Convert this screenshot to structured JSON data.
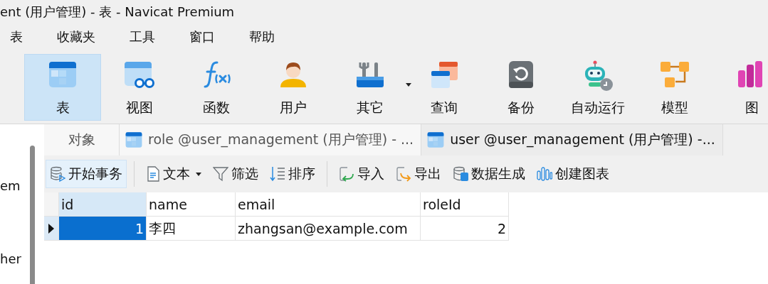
{
  "window": {
    "title": "ent (用户管理) - 表 - Navicat Premium"
  },
  "menu": [
    "表",
    "收藏夹",
    "工具",
    "窗口",
    "帮助"
  ],
  "toolbar": [
    {
      "label": "表",
      "kind": "table",
      "selected": true,
      "dropdown": false
    },
    {
      "label": "视图",
      "kind": "view",
      "selected": false,
      "dropdown": false
    },
    {
      "label": "函数",
      "kind": "function",
      "selected": false,
      "dropdown": false
    },
    {
      "label": "用户",
      "kind": "user",
      "selected": false,
      "dropdown": false
    },
    {
      "label": "其它",
      "kind": "tools",
      "selected": false,
      "dropdown": true
    },
    {
      "label": "查询",
      "kind": "query",
      "selected": false,
      "dropdown": false
    },
    {
      "label": "备份",
      "kind": "backup",
      "selected": false,
      "dropdown": false
    },
    {
      "label": "自动运行",
      "kind": "robot",
      "selected": false,
      "dropdown": false
    },
    {
      "label": "模型",
      "kind": "model",
      "selected": false,
      "dropdown": false
    },
    {
      "label": "图",
      "kind": "chart",
      "selected": false,
      "dropdown": false
    }
  ],
  "sidebar": {
    "items": [
      "em",
      "her"
    ]
  },
  "tabs": [
    {
      "label": "对象",
      "kind": "objects",
      "selected": false
    },
    {
      "label": "role @user_management (用户管理) - ...",
      "kind": "table",
      "selected": false
    },
    {
      "label": "user @user_management (用户管理) -...",
      "kind": "table",
      "selected": true
    }
  ],
  "data_toolbar": [
    {
      "label": "开始事务",
      "kind": "transaction",
      "pressed": true,
      "dropdown": false
    },
    {
      "label": "文本",
      "kind": "text",
      "pressed": false,
      "dropdown": true
    },
    {
      "label": "筛选",
      "kind": "filter",
      "pressed": false,
      "dropdown": false
    },
    {
      "label": "排序",
      "kind": "sort",
      "pressed": false,
      "dropdown": false
    },
    {
      "label": "导入",
      "kind": "import",
      "pressed": false,
      "dropdown": false
    },
    {
      "label": "导出",
      "kind": "export",
      "pressed": false,
      "dropdown": false
    },
    {
      "label": "数据生成",
      "kind": "generate",
      "pressed": false,
      "dropdown": false
    },
    {
      "label": "创建图表",
      "kind": "chart",
      "pressed": false,
      "dropdown": false
    }
  ],
  "table": {
    "columns": [
      {
        "label": "id",
        "selected": true,
        "kind": "number"
      },
      {
        "label": "name",
        "selected": false,
        "kind": "text"
      },
      {
        "label": "email",
        "selected": false,
        "kind": "text"
      },
      {
        "label": "roleId",
        "selected": false,
        "kind": "number"
      }
    ],
    "rows": [
      {
        "current": true,
        "cells": [
          {
            "text": "1",
            "selected": true
          },
          {
            "text": "李四",
            "selected": false
          },
          {
            "text": "zhangsan@example.com",
            "selected": false
          },
          {
            "text": "2",
            "selected": false
          }
        ]
      }
    ]
  }
}
